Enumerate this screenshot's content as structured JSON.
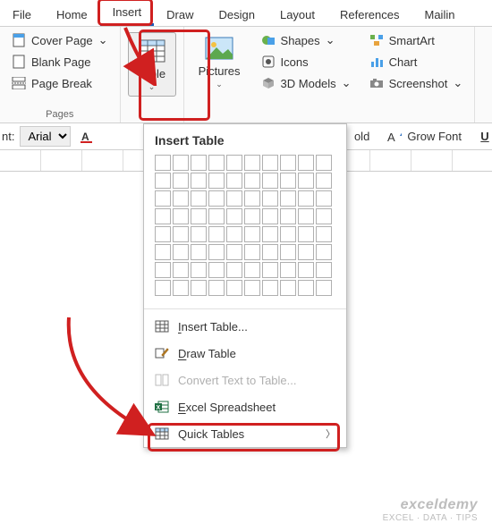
{
  "tabs": {
    "file": "File",
    "home": "Home",
    "insert": "Insert",
    "draw": "Draw",
    "design": "Design",
    "layout": "Layout",
    "references": "References",
    "mailings": "Mailin"
  },
  "pages_group": {
    "cover_page": "Cover Page",
    "blank_page": "Blank Page",
    "page_break": "Page Break",
    "label": "Pages"
  },
  "table_btn": "Table",
  "pictures_btn": "Pictures",
  "illus": {
    "shapes": "Shapes",
    "icons": "Icons",
    "models": "3D Models",
    "smartart": "SmartArt",
    "chart": "Chart",
    "screenshot": "Screenshot"
  },
  "formatbar": {
    "font_label": "nt:",
    "font_value": "Arial",
    "bold": "old",
    "grow_font": "Grow Font"
  },
  "dropdown": {
    "title": "Insert Table",
    "insert_table": "Insert Table...",
    "draw_table": "Draw Table",
    "convert": "Convert Text to Table...",
    "excel": "Excel Spreadsheet",
    "quick": "Quick Tables"
  },
  "watermark": {
    "brand": "exceldemy",
    "tag": "EXCEL · DATA · TIPS"
  }
}
